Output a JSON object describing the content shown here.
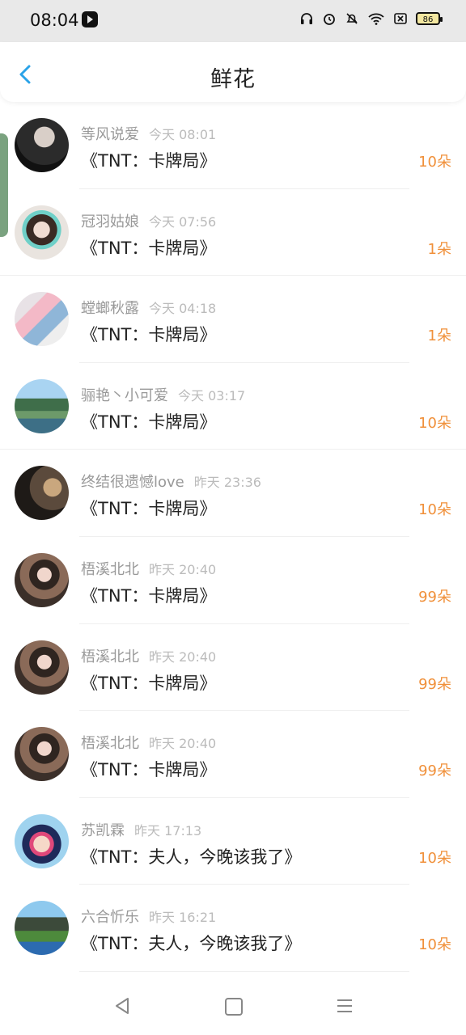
{
  "status_bar": {
    "time": "08:04",
    "battery": "86",
    "icons": [
      "headphones-icon",
      "alarm-icon",
      "bell-off-icon",
      "wifi-icon",
      "sim-icon",
      "battery-icon"
    ]
  },
  "header": {
    "title": "鲜花",
    "back_icon": "chevron-left-icon"
  },
  "colors": {
    "accent": "#f0903a",
    "back": "#2aa3e8",
    "side_tab": "#7aa27f"
  },
  "items": [
    {
      "name": "等风说爱",
      "time": "今天 08:01",
      "work": "《TNT：卡牌局》",
      "qty": "10朵"
    },
    {
      "name": "冠羽姑娘",
      "time": "今天 07:56",
      "work": "《TNT：卡牌局》",
      "qty": "1朵"
    },
    {
      "name": "螳螂秋露",
      "time": "今天 04:18",
      "work": "《TNT：卡牌局》",
      "qty": "1朵"
    },
    {
      "name": "骊艳丶小可爱",
      "time": "今天 03:17",
      "work": "《TNT：卡牌局》",
      "qty": "10朵"
    },
    {
      "name": "终结很遗憾love",
      "time": "昨天 23:36",
      "work": "《TNT：卡牌局》",
      "qty": "10朵"
    },
    {
      "name": "梧溪北北",
      "time": "昨天 20:40",
      "work": "《TNT：卡牌局》",
      "qty": "99朵"
    },
    {
      "name": "梧溪北北",
      "time": "昨天 20:40",
      "work": "《TNT：卡牌局》",
      "qty": "99朵"
    },
    {
      "name": "梧溪北北",
      "time": "昨天 20:40",
      "work": "《TNT：卡牌局》",
      "qty": "99朵"
    },
    {
      "name": "苏凯霖",
      "time": "昨天 17:13",
      "work": "《TNT：夫人，今晚该我了》",
      "qty": "10朵"
    },
    {
      "name": "六合忻乐",
      "time": "昨天 16:21",
      "work": "《TNT：夫人，今晚该我了》",
      "qty": "10朵"
    }
  ],
  "nav": {
    "back_icon": "triangle-back-icon",
    "home_icon": "square-home-icon",
    "menu_icon": "menu-lines-icon"
  }
}
